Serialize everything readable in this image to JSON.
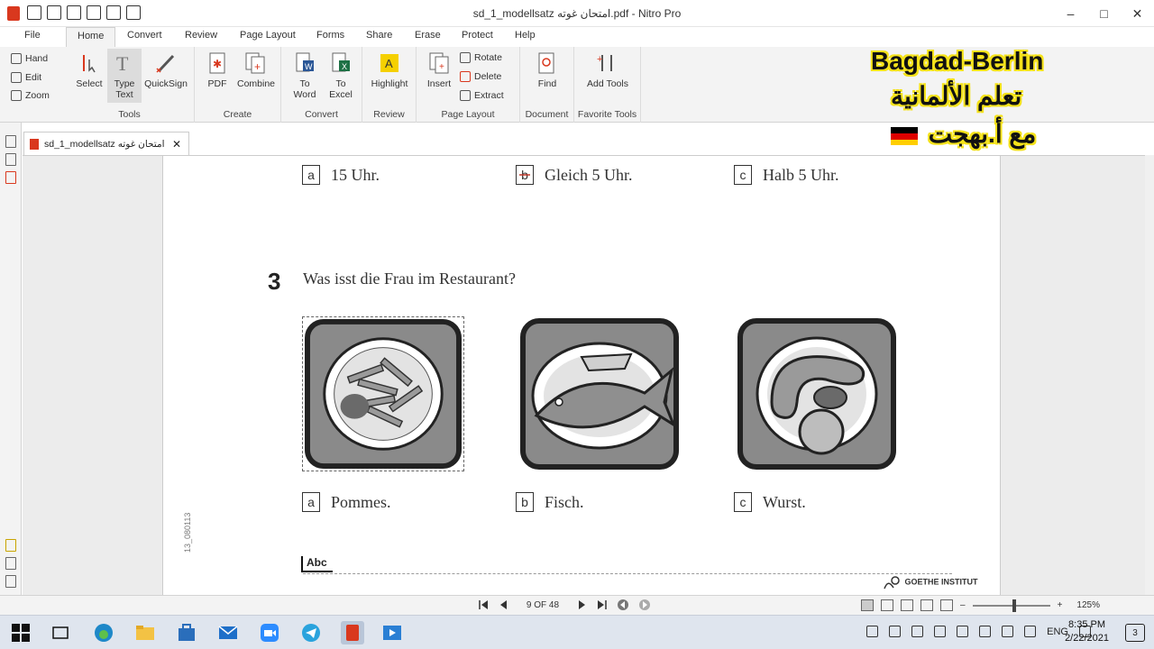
{
  "window": {
    "title": "sd_1_modellsatz امتحان غوته.pdf - Nitro Pro",
    "controls": [
      "–",
      "□",
      "✕"
    ]
  },
  "menu": {
    "tabs": [
      "File",
      "Home",
      "Convert",
      "Review",
      "Page Layout",
      "Forms",
      "Share",
      "Erase",
      "Protect",
      "Help"
    ],
    "active": "Home"
  },
  "ribbon": {
    "hand": "Hand",
    "edit": "Edit",
    "zoom": "Zoom",
    "select": "Select",
    "type_text": "Type Text",
    "quicksign": "QuickSign",
    "tools_label": "Tools",
    "pdf": "PDF",
    "combine": "Combine",
    "create_label": "Create",
    "to_word": "To Word",
    "to_excel": "To Excel",
    "convert_label": "Convert",
    "highlight": "Highlight",
    "review_label": "Review",
    "insert": "Insert",
    "rotate": "Rotate",
    "delete": "Delete",
    "extract": "Extract",
    "page_layout_label": "Page Layout",
    "find": "Find",
    "document_label": "Document",
    "add_tools": "Add Tools",
    "favorite_label": "Favorite Tools"
  },
  "watermark": {
    "line1": "Bagdad-Berlin",
    "line2": "تعلم الألمانية",
    "line3": "مع أ.بهجت"
  },
  "doc_tab": {
    "label": "sd_1_modellsatz امتحان غوته",
    "close": "✕"
  },
  "page": {
    "prev_options": [
      {
        "letter": "a",
        "text": "15 Uhr."
      },
      {
        "letter": "b",
        "text": "Gleich 5 Uhr."
      },
      {
        "letter": "c",
        "text": "Halb 5 Uhr."
      }
    ],
    "question_number": "3",
    "question_text": "Was isst die Frau im Restaurant?",
    "options": [
      {
        "letter": "a",
        "text": "Pommes."
      },
      {
        "letter": "b",
        "text": "Fisch."
      },
      {
        "letter": "c",
        "text": "Wurst."
      }
    ],
    "annotation": "Abc",
    "page_code": "13_080113",
    "footer_logo": "GOETHE INSTITUT"
  },
  "statusbar": {
    "page_indicator": "9 OF 48",
    "zoom_level": "125%",
    "zoom_minus": "–",
    "zoom_plus": "+"
  },
  "taskbar": {
    "lang": "ENG",
    "time": "8:35 PM",
    "date": "2/22/2021",
    "notifications": "3"
  }
}
